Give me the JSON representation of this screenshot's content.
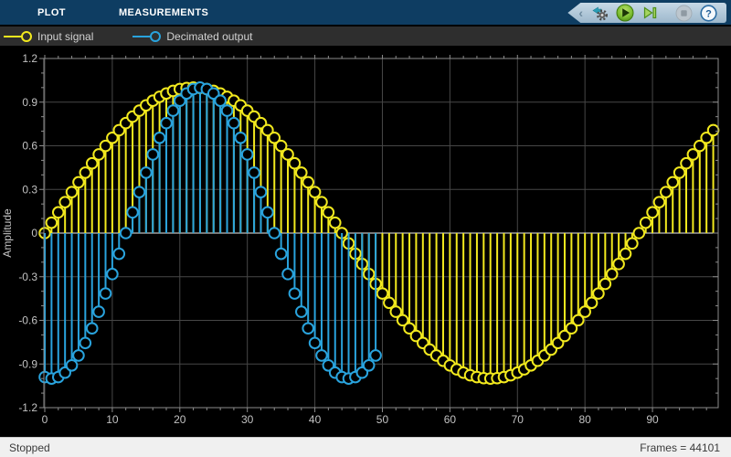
{
  "tabbar": {
    "tabs": [
      {
        "label": "PLOT"
      },
      {
        "label": "MEASUREMENTS"
      }
    ],
    "bg_color": "#0e3d62"
  },
  "toolbar": {
    "icons": [
      {
        "name": "simulink-gear-icon"
      },
      {
        "name": "run-icon"
      },
      {
        "name": "step-forward-icon"
      },
      {
        "name": "stop-icon",
        "disabled": true
      },
      {
        "name": "help-icon"
      }
    ]
  },
  "legend": {
    "items": [
      {
        "label": "Input signal",
        "color": "#f2e91e"
      },
      {
        "label": "Decimated output",
        "color": "#29a3dd"
      }
    ]
  },
  "chart_data": {
    "type": "stem",
    "ylabel": "Amplitude",
    "xlabel": "",
    "title": "",
    "xlim": [
      0,
      99.6
    ],
    "ylim": [
      -1.2,
      1.2
    ],
    "x_ticks": [
      0,
      10,
      20,
      30,
      40,
      50,
      60,
      70,
      80,
      90
    ],
    "y_ticks": [
      -1.2,
      -0.9,
      -0.6,
      -0.3,
      0,
      0.3,
      0.6,
      0.9,
      1.2
    ],
    "y_tick_labels": [
      "-1.2",
      "-0.9",
      "-0.6",
      "-0.3",
      "0",
      "0.3",
      "0.6",
      "0.9",
      "1.2"
    ],
    "x_minor_step": 2,
    "y_minor_step": 0.1,
    "grid": true,
    "legend_position": "top-bar",
    "background": "#000000",
    "grid_color": "#474747",
    "axis_color": "#8c8c8c",
    "tick_color": "#c2c2c2",
    "baseline_color": "#eeeeee",
    "series": [
      {
        "name": "Input signal",
        "color": "#f2e91e",
        "x_start": 0,
        "values": [
          0,
          0.0713,
          0.1423,
          0.2126,
          0.2817,
          0.3494,
          0.4154,
          0.4792,
          0.5406,
          0.5992,
          0.6549,
          0.7071,
          0.7557,
          0.8005,
          0.8413,
          0.8778,
          0.9096,
          0.9368,
          0.9595,
          0.9772,
          0.9898,
          0.9974,
          1,
          0.9974,
          0.9898,
          0.9772,
          0.9595,
          0.9368,
          0.9096,
          0.8778,
          0.8413,
          0.8005,
          0.7557,
          0.7071,
          0.6549,
          0.5992,
          0.5406,
          0.4792,
          0.4154,
          0.3494,
          0.2817,
          0.2126,
          0.1423,
          0.0713,
          0,
          -0.0713,
          -0.1423,
          -0.2126,
          -0.2817,
          -0.3494,
          -0.4154,
          -0.4792,
          -0.5406,
          -0.5992,
          -0.6549,
          -0.7071,
          -0.7557,
          -0.8005,
          -0.8413,
          -0.8778,
          -0.9096,
          -0.9368,
          -0.9595,
          -0.9772,
          -0.9898,
          -0.9974,
          -1,
          -0.9974,
          -0.9898,
          -0.9772,
          -0.9595,
          -0.9368,
          -0.9096,
          -0.8778,
          -0.8413,
          -0.8005,
          -0.7557,
          -0.7071,
          -0.6549,
          -0.5992,
          -0.5406,
          -0.4792,
          -0.4154,
          -0.3494,
          -0.2817,
          -0.2126,
          -0.1423,
          -0.0713,
          0,
          0.0713,
          0.1423,
          0.2126,
          0.2817,
          0.3494,
          0.4154,
          0.4792,
          0.5406,
          0.5992,
          0.6549,
          0.7071
        ]
      },
      {
        "name": "Decimated output",
        "color": "#29a3dd",
        "x_start": 0,
        "values": [
          -0.9898,
          -1,
          -0.9898,
          -0.9595,
          -0.9096,
          -0.8413,
          -0.7557,
          -0.6549,
          -0.5406,
          -0.4154,
          -0.2817,
          -0.1423,
          0,
          0.1423,
          0.2817,
          0.4154,
          0.5406,
          0.6549,
          0.7557,
          0.8413,
          0.9096,
          0.9595,
          0.9898,
          1,
          0.9898,
          0.9595,
          0.9096,
          0.8413,
          0.7557,
          0.6549,
          0.5406,
          0.4154,
          0.2817,
          0.1423,
          0,
          -0.1423,
          -0.2817,
          -0.4154,
          -0.5406,
          -0.6549,
          -0.7557,
          -0.8413,
          -0.9096,
          -0.9595,
          -0.9898,
          -1,
          -0.9898,
          -0.9595,
          -0.9096,
          -0.8413
        ]
      }
    ]
  },
  "statusbar": {
    "left": "Stopped",
    "right": "Frames = 44101"
  }
}
